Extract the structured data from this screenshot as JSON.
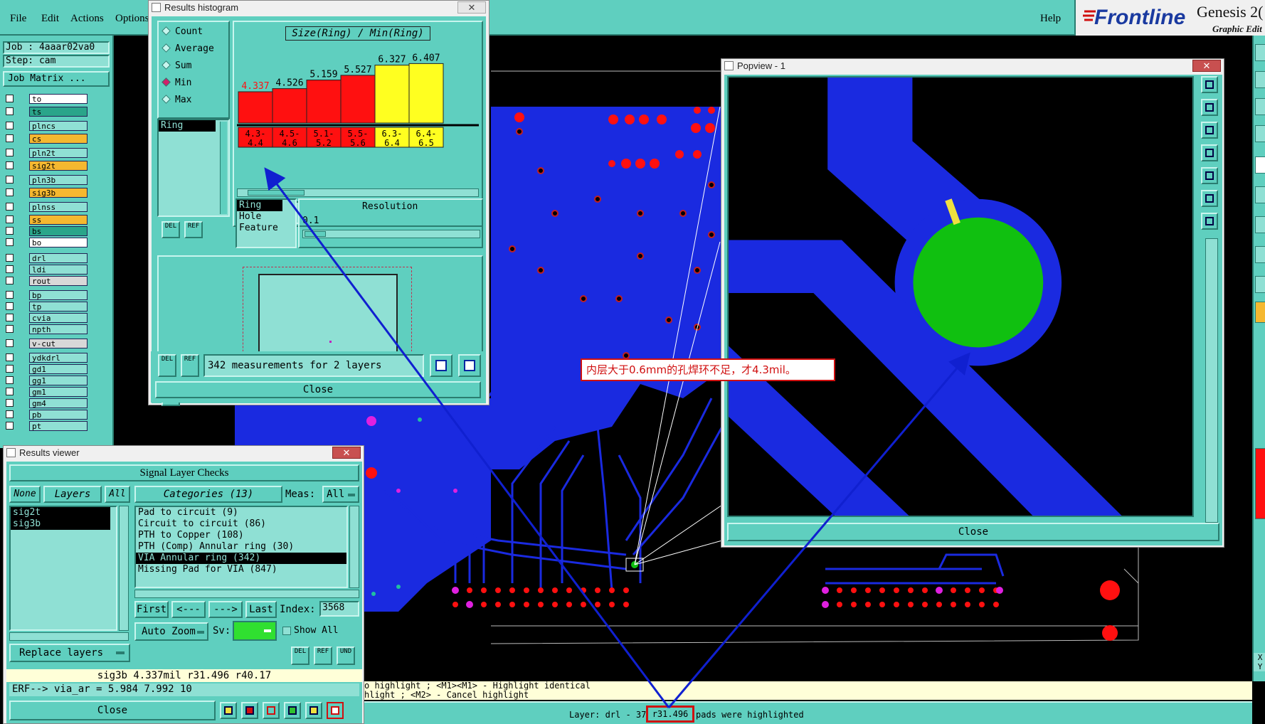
{
  "menu": {
    "items": [
      "File",
      "Edit",
      "Actions",
      "Options"
    ],
    "help": "Help"
  },
  "brand": {
    "logo": "Frontline",
    "app_name": "Genesis 2(",
    "subtitle": "Graphic Edit"
  },
  "job_panel": {
    "job": "Job : 4aaar02va0",
    "step": "Step: cam",
    "matrix_button": "Job Matrix ..."
  },
  "layers": [
    {
      "name": "to",
      "color": "#ffffff"
    },
    {
      "name": "ts",
      "color": "#2aa58a"
    },
    {
      "name": "plncs",
      "color": "#8fe0d4"
    },
    {
      "name": "cs",
      "color": "#f5b830"
    },
    {
      "name": "pln2t",
      "color": "#8fe0d4"
    },
    {
      "name": "sig2t",
      "color": "#f5b830"
    },
    {
      "name": "pln3b",
      "color": "#8fe0d4"
    },
    {
      "name": "sig3b",
      "color": "#f5b830"
    },
    {
      "name": "plnss",
      "color": "#8fe0d4"
    },
    {
      "name": "ss",
      "color": "#f5b830"
    },
    {
      "name": "bs",
      "color": "#2aa58a"
    },
    {
      "name": "bo",
      "color": "#ffffff"
    },
    {
      "name": "drl",
      "color": "#8fe0d4"
    },
    {
      "name": "ldi",
      "color": "#8fe0d4"
    },
    {
      "name": "rout",
      "color": "#d8d8d8"
    },
    {
      "name": "bp",
      "color": "#8fe0d4"
    },
    {
      "name": "tp",
      "color": "#8fe0d4"
    },
    {
      "name": "cvia",
      "color": "#8fe0d4"
    },
    {
      "name": "npth",
      "color": "#8fe0d4"
    },
    {
      "name": "v-cut",
      "color": "#d8d8d8"
    },
    {
      "name": "ydkdrl",
      "color": "#8fe0d4"
    },
    {
      "name": "gd1",
      "color": "#8fe0d4"
    },
    {
      "name": "gg1",
      "color": "#8fe0d4"
    },
    {
      "name": "gm1",
      "color": "#8fe0d4"
    },
    {
      "name": "gm4",
      "color": "#8fe0d4"
    },
    {
      "name": "pb",
      "color": "#8fe0d4"
    },
    {
      "name": "pt",
      "color": "#8fe0d4"
    }
  ],
  "histogram": {
    "window_title": "Results histogram",
    "options": [
      "Count",
      "Average",
      "Sum",
      "Min",
      "Max"
    ],
    "selected_option": "Min",
    "list_item": "Ring",
    "chart_title": "Size(Ring) / Min(Ring)",
    "bars": [
      {
        "value": "4.337",
        "range": "4.3-\n4.4",
        "color": "red"
      },
      {
        "value": "4.526",
        "range": "4.5-\n4.6",
        "color": "red"
      },
      {
        "value": "5.159",
        "range": "5.1-\n5.2",
        "color": "red"
      },
      {
        "value": "5.527",
        "range": "5.5-\n5.6",
        "color": "red"
      },
      {
        "value": "6.327",
        "range": "6.3-\n6.4",
        "color": "yellow"
      },
      {
        "value": "6.407",
        "range": "6.4-\n6.5",
        "color": "yellow"
      }
    ],
    "bar_levels": [
      0.4,
      0.44,
      0.55,
      0.61,
      0.74,
      0.76
    ],
    "attr_list": [
      "Ring",
      "Hole",
      "Feature"
    ],
    "resolution_label": "Resolution",
    "resolution_value": "0.1",
    "measurements": "342 measurements for 2 layers",
    "close": "Close",
    "del": "DEL",
    "ref": "REF"
  },
  "popview": {
    "window_title": "Popview - 1",
    "close": "Close"
  },
  "annotation": "内层大于0.6mm的孔焊环不足，才4.3mil。",
  "results_viewer": {
    "window_title": "Results viewer",
    "header": "Signal Layer Checks",
    "none_btn": "None",
    "layers_btn": "Layers",
    "all_btn": "All",
    "layers": [
      "sig2t",
      "sig3b"
    ],
    "categories_btn": "Categories (13)",
    "meas_label": "Meas:",
    "meas_value": "All",
    "categories": [
      "Pad to circuit (9)",
      "Circuit to circuit (86)",
      "PTH to Copper (108)",
      "PTH (Comp) Annular ring (30)",
      "VIA Annular ring (342)",
      "Missing Pad for VIA (847)"
    ],
    "selected_category": "VIA Annular ring (342)",
    "first": "First",
    "prev": "<---",
    "next": "--->",
    "last": "Last",
    "index_label": "Index:",
    "index_value": "3568",
    "auto_zoom": "Auto Zoom",
    "sv_label": "Sv:",
    "show_all": "Show All",
    "replace_layers": "Replace layers",
    "status": "sig3b 4.337mil  r31.496  r40.17",
    "erf": "ERF--> via_ar = 5.984 7.992 10",
    "close": "Close",
    "und": "UND"
  },
  "status_bar": {
    "line1": "o highlight ; <M1><M1> - Highlight identical",
    "line2": "hlight ; <M2> - Cancel highlight",
    "line3_prefix": "Layer: drl - 37",
    "line3_box": "r31.496",
    "line3_suffix": "pads were highlighted"
  },
  "side_xy": "X\nY"
}
